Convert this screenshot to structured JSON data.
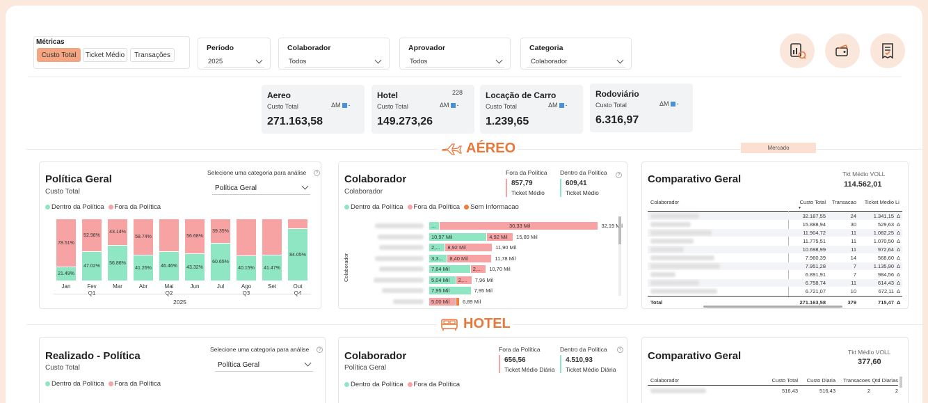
{
  "metrics": {
    "label": "Métricas",
    "buttons": [
      "Custo Total",
      "Ticket Médio",
      "Transações"
    ],
    "active": "Custo Total"
  },
  "filters": [
    {
      "label": "Período",
      "value": "2025"
    },
    {
      "label": "Colaborador",
      "value": "Todos"
    },
    {
      "label": "Aprovador",
      "value": "Todos"
    },
    {
      "label": "Categoria",
      "value": "Colaborador"
    }
  ],
  "header_icons": [
    "report-chart-icon",
    "wallet-card-icon",
    "receipt-check-icon"
  ],
  "kpis": [
    {
      "title": "Aereo",
      "sub": "Custo Total",
      "delta": "ΔM",
      "dash": "-",
      "value": "271.163,58",
      "note": ""
    },
    {
      "title": "Hotel",
      "sub": "Custo Total",
      "delta": "ΔM",
      "dash": "-",
      "value": "149.273,26",
      "note": "228"
    },
    {
      "title": "Locação de Carro",
      "sub": "Custo Total",
      "delta": "ΔM",
      "dash": "-",
      "value": "1.239,65",
      "note": ""
    },
    {
      "title": "Rodoviário",
      "sub": "Custo Total",
      "delta": "ΔM",
      "dash": "-",
      "value": "6.316,97",
      "note": ""
    }
  ],
  "sections": {
    "aereo": "AÉREO",
    "hotel": "HOTEL",
    "mercado": "Mercado"
  },
  "aereo": {
    "politica": {
      "title": "Política Geral",
      "sub": "Custo Total",
      "select_label": "Selecione uma categoria para análise",
      "select_value": "Política Geral",
      "legend": [
        "Dentro da Política",
        "Fora da Política"
      ],
      "year": "2025"
    },
    "colaborador": {
      "title": "Colaborador",
      "sub": "Colaborador",
      "fora_label": "Fora da Política",
      "fora_value": "857,79",
      "fora_sub": "Ticket Médio",
      "dentro_label": "Dentro da Política",
      "dentro_value": "609,41",
      "dentro_sub": "Ticket Médio",
      "legend": [
        "Dentro da Política",
        "Fora da Política",
        "Sem Informacao"
      ],
      "axis_label": "Colaborador"
    },
    "comparativo": {
      "title": "Comparativo Geral",
      "tkt_label": "Tkt Médio VOLL",
      "tkt_value": "114.562,01",
      "columns": [
        "Colaborador",
        "Custo Total",
        "Transacao",
        "Ticket Medio",
        "Li"
      ],
      "rows": [
        {
          "custo": "32.187,55",
          "trans": "24",
          "ticket": "1.341,15",
          "d": "Δ"
        },
        {
          "custo": "15.888,94",
          "trans": "30",
          "ticket": "529,63",
          "d": "Δ"
        },
        {
          "custo": "11.904,72",
          "trans": "11",
          "ticket": "1.082,25",
          "d": "Δ"
        },
        {
          "custo": "11.775,51",
          "trans": "11",
          "ticket": "1.070,50",
          "d": "Δ"
        },
        {
          "custo": "10.698,99",
          "trans": "11",
          "ticket": "972,64",
          "d": "Δ"
        },
        {
          "custo": "7.960,39",
          "trans": "14",
          "ticket": "568,60",
          "d": "Δ"
        },
        {
          "custo": "7.951,28",
          "trans": "7",
          "ticket": "1.135,90",
          "d": "Δ"
        },
        {
          "custo": "6.891,91",
          "trans": "7",
          "ticket": "984,56",
          "d": "Δ"
        },
        {
          "custo": "6.758,74",
          "trans": "11",
          "ticket": "614,43",
          "d": "Δ"
        },
        {
          "custo": "6.721,07",
          "trans": "10",
          "ticket": "672,11",
          "d": "Δ"
        }
      ],
      "total": {
        "label": "Total",
        "custo": "271.163,58",
        "trans": "379",
        "ticket": "715,47",
        "d": "Δ"
      }
    }
  },
  "hotel": {
    "realizado": {
      "title": "Realizado - Política",
      "sub": "Custo Total",
      "select_label": "Selecione uma categoria para análise",
      "select_value": "Política Geral",
      "legend": [
        "Dentro da Política",
        "Fora da Política"
      ]
    },
    "colaborador": {
      "title": "Colaborador",
      "sub": "Política Geral",
      "fora_label": "Fora da Política",
      "fora_value": "656,56",
      "fora_sub": "Ticket Médio Diária",
      "dentro_label": "Dentro da Política",
      "dentro_value": "4.510,93",
      "dentro_sub": "Ticket Médio Diária",
      "legend": [
        "Dentro da Política",
        "Fora da Política"
      ]
    },
    "comparativo": {
      "title": "Comparativo Geral",
      "tkt_label": "Tkt Médio VOLL",
      "tkt_value": "377,60",
      "columns": [
        "Colaborador",
        "Custo Total",
        "Custo Diaria",
        "Transacoes",
        "Qtd Diarias"
      ],
      "first_row": [
        "516,43",
        "516,43",
        "2",
        "2"
      ]
    }
  },
  "colors": {
    "accent": "#e8773a",
    "dentro": "#8ee6c2",
    "fora": "#f7a3a3",
    "sem": "#f07e3a"
  },
  "chart_data": [
    {
      "type": "bar",
      "title": "Política Geral",
      "categories": [
        "Jan",
        "Fev",
        "Mar",
        "Abr",
        "Mai",
        "Jun",
        "Jul",
        "Ago",
        "Set",
        "Out"
      ],
      "quarters": [
        "Q1",
        "Q2",
        "Q3",
        "Q4"
      ],
      "stacked": "percent",
      "series": [
        {
          "name": "Dentro da Política",
          "values": [
            21.49,
            47.02,
            56.86,
            41.26,
            46.46,
            43.32,
            60.65,
            40.15,
            41.47,
            84.05
          ],
          "labels": [
            "21.49%",
            "47.02%",
            "56.86%",
            "41.26%",
            "46.46%",
            "43.32%",
            "60.65%",
            "40.15%",
            "41.47%",
            "84.05%"
          ]
        },
        {
          "name": "Fora da Política",
          "values": [
            78.51,
            52.98,
            43.14,
            58.74,
            53.54,
            56.68,
            39.35,
            59.85,
            58.53,
            15.95
          ],
          "labels": [
            "78.51%",
            "52.98%",
            "43.14%",
            "58.74%",
            "",
            "56.68%",
            "39.35%",
            "",
            "",
            ""
          ]
        }
      ]
    },
    {
      "type": "bar",
      "orientation": "horizontal",
      "title": "Colaborador",
      "ylabel": "Colaborador",
      "totals": [
        30.33,
        15.89,
        11.9,
        11.78,
        10.7,
        7.96,
        7.95,
        6.89
      ],
      "total_labels": [
        "32,19 Mil",
        "15,89 Mil",
        "11,90 Mil",
        "11,78 Mil",
        "10,70 Mil",
        "7,96 Mil",
        "7,95 Mil",
        "6,89 Mil"
      ],
      "series": [
        {
          "name": "Dentro da Política",
          "values": [
            1.86,
            10.97,
            2.98,
            3.38,
            7.84,
            5.04,
            7.95,
            0
          ],
          "labels": [
            "...",
            "10,97 Mil",
            "2,...",
            "3,3...",
            "7,84 Mil",
            "5,04 Mil",
            "7,95 Mil",
            ""
          ]
        },
        {
          "name": "Fora da Política",
          "values": [
            30.33,
            4.92,
            8.92,
            8.4,
            2.86,
            2.92,
            0,
            5.0
          ],
          "labels": [
            "30,33 Mil",
            "4,92 Mil",
            "8,92 Mil",
            "8,40 Mil",
            "2,...",
            "2,...",
            "",
            "5,00 Mil"
          ]
        },
        {
          "name": "Sem Informacao",
          "values": [
            0,
            0,
            0,
            0,
            0,
            0,
            0,
            0.6
          ],
          "labels": [
            "",
            "",
            "",
            "",
            "",
            "",
            "",
            ""
          ]
        }
      ]
    }
  ]
}
